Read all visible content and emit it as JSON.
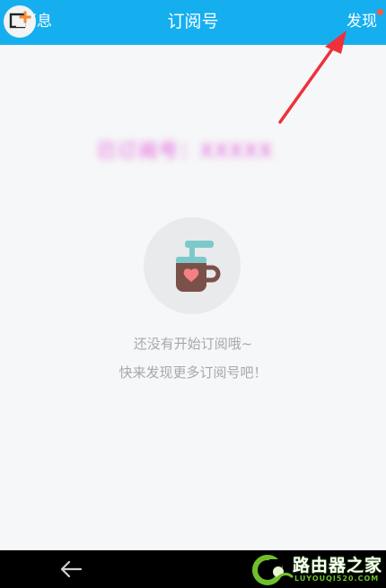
{
  "header": {
    "left_label": "消息",
    "title": "订阅号",
    "right_label": "发现",
    "has_notification": true
  },
  "content": {
    "blurred_account_label": "已订阅号：XXXXX",
    "empty_line1": "还没有开始订阅哦~",
    "empty_line2": "快来发现更多订阅号吧！",
    "empty_icon": "coffee-cup-heart-icon"
  },
  "navigation": {
    "back_icon": "back-arrow-icon"
  },
  "watermark": {
    "brand": "路由器之家",
    "domain": "LUYOUQI520.COM"
  },
  "colors": {
    "header_bg": "#15aff0",
    "page_bg": "#f6f7f8",
    "annotation_arrow": "#f0303a",
    "notification_dot": "#ff5a36",
    "accent_pink": "#e052d7"
  }
}
